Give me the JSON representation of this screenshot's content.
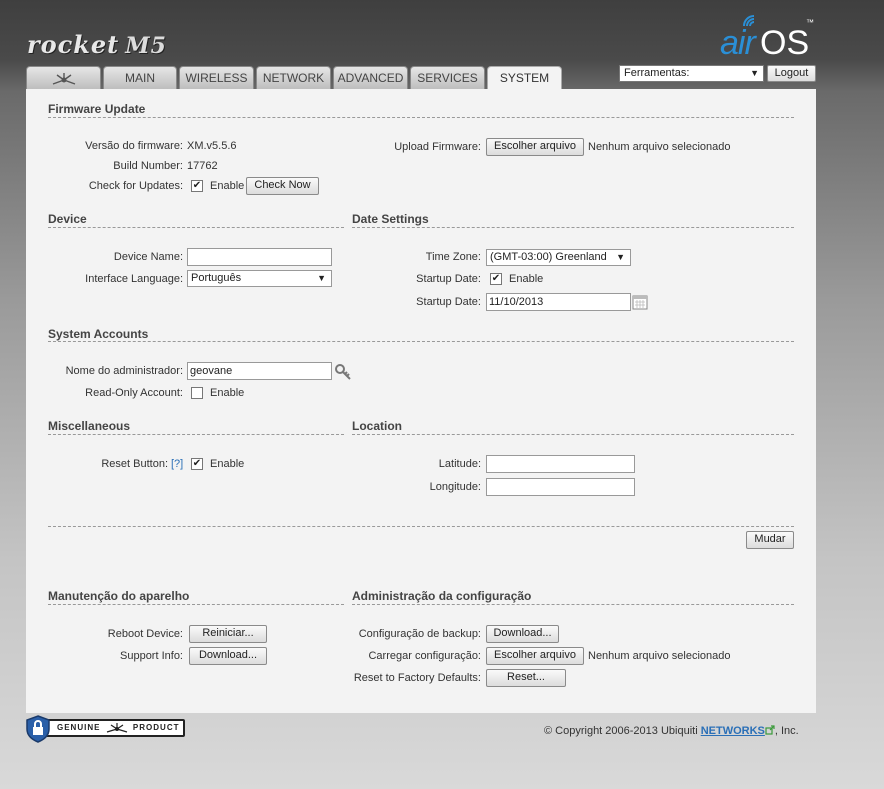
{
  "header": {
    "product_name": "rocket",
    "product_model": "M5",
    "brand_air": "air",
    "brand_os": "OS",
    "brand_tm": "™"
  },
  "tabs": [
    {
      "label": "",
      "icon": "ubiquiti-logo-icon",
      "active": false
    },
    {
      "label": "MAIN",
      "active": false
    },
    {
      "label": "WIRELESS",
      "active": false
    },
    {
      "label": "NETWORK",
      "active": false
    },
    {
      "label": "ADVANCED",
      "active": false
    },
    {
      "label": "SERVICES",
      "active": false
    },
    {
      "label": "SYSTEM",
      "active": true
    }
  ],
  "tools": {
    "select_value": "Ferramentas:",
    "logout_label": "Logout"
  },
  "firmware": {
    "title": "Firmware Update",
    "version_label": "Versão do firmware:",
    "version_value": "XM.v5.5.6",
    "build_label": "Build Number:",
    "build_value": "17762",
    "check_label": "Check for Updates:",
    "check_enable": "Enable",
    "check_now": "Check Now",
    "upload_label": "Upload Firmware:",
    "upload_button": "Escolher arquivo",
    "upload_status": "Nenhum arquivo selecionado"
  },
  "device": {
    "title": "Device",
    "name_label": "Device Name:",
    "name_value": "",
    "language_label": "Interface Language:",
    "language_value": "Português"
  },
  "date": {
    "title": "Date Settings",
    "timezone_label": "Time Zone:",
    "timezone_value": "(GMT-03:00) Greenland",
    "startup_label": "Startup Date:",
    "startup_enable": "Enable",
    "startup_date_label": "Startup Date:",
    "startup_date_value": "11/10/2013"
  },
  "accounts": {
    "title": "System Accounts",
    "admin_label": "Nome do administrador:",
    "admin_value": "geovane",
    "readonly_label": "Read-Only Account:",
    "readonly_enable": "Enable"
  },
  "misc": {
    "title": "Miscellaneous",
    "reset_label": "Reset Button:",
    "reset_help": "[?]",
    "reset_enable": "Enable"
  },
  "location": {
    "title": "Location",
    "latitude_label": "Latitude:",
    "latitude_value": "",
    "longitude_label": "Longitude:",
    "longitude_value": ""
  },
  "actions": {
    "change_label": "Mudar"
  },
  "maintenance": {
    "title": "Manutenção do aparelho",
    "reboot_label": "Reboot Device:",
    "reboot_button": "Reiniciar...",
    "support_label": "Support Info:",
    "support_button": "Download..."
  },
  "config_admin": {
    "title": "Administração da configuração",
    "backup_label": "Configuração de backup:",
    "backup_button": "Download...",
    "load_label": "Carregar configuração:",
    "load_button": "Escolher arquivo",
    "load_status": "Nenhum arquivo selecionado",
    "reset_label": "Reset to Factory Defaults:",
    "reset_button": "Reset..."
  },
  "footer": {
    "genuine_text": "GENUINE",
    "product_text": "PRODUCT",
    "copyright_prefix": "© Copyright 2006-2013 Ubiquiti",
    "networks": "NETWORKS",
    "copyright_suffix": ", Inc."
  },
  "colors": {
    "accent_blue": "#2a8fd6",
    "link_blue": "#2a6fb7",
    "panel_bg": "#f3f3f3"
  }
}
